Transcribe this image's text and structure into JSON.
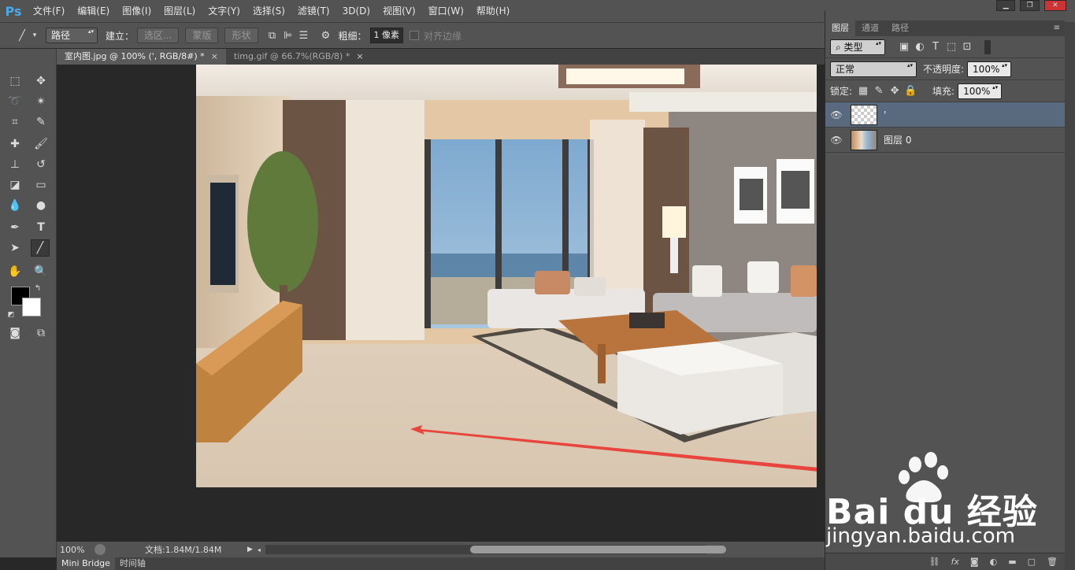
{
  "app": {
    "logo": "Ps"
  },
  "menu": [
    "文件(F)",
    "编辑(E)",
    "图像(I)",
    "图层(L)",
    "文字(Y)",
    "选择(S)",
    "滤镜(T)",
    "3D(D)",
    "视图(V)",
    "窗口(W)",
    "帮助(H)"
  ],
  "options": {
    "mode": "路径",
    "build_label": "建立：",
    "selection_btn": "选区...",
    "mask_btn": "蒙版",
    "shape_btn": "形状",
    "weight_label": "粗细：",
    "weight_value": "1 像素",
    "align_edges": "对齐边缘"
  },
  "tabs": [
    {
      "label": "室内图.jpg @ 100% (', RGB/8#) *",
      "close": "×"
    },
    {
      "label": "timg.gif @ 66.7%(RGB/8) *",
      "close": "×"
    }
  ],
  "status": {
    "zoom": "100%",
    "doc_info": "文档:1.84M/1.84M"
  },
  "bottom_tabs": [
    "Mini Bridge",
    "时间轴"
  ],
  "layers_panel": {
    "tabs": [
      "图层",
      "通道",
      "路径"
    ],
    "filter": "类型",
    "blend": "正常",
    "opacity_label": "不透明度:",
    "opacity": "100%",
    "lock_label": "锁定:",
    "fill_label": "填充:",
    "fill": "100%",
    "layers": [
      {
        "name": "'",
        "selected": true
      },
      {
        "name": "图层 0",
        "selected": false
      }
    ],
    "bottom_icons": [
      "fx"
    ]
  },
  "watermark": {
    "brand": "Bai du 经验",
    "url": "jingyan.baidu.com"
  },
  "colors": {
    "accent": "#4aa9e8",
    "panel": "#535353",
    "arrow": "#e8453c"
  }
}
